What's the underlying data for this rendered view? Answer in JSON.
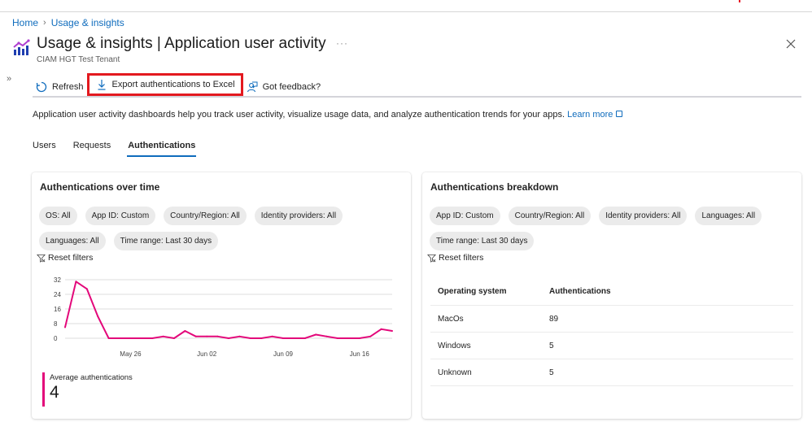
{
  "breadcrumb": {
    "items": [
      "Home",
      "Usage & insights"
    ]
  },
  "header": {
    "title_main": "Usage & insights",
    "title_sep": " | ",
    "title_page": "Application user activity",
    "subtitle": "CIAM HGT Test Tenant",
    "more_label": "···",
    "icon": "analytics-chart-icon"
  },
  "toolbar": {
    "refresh_label": "Refresh",
    "export_label": "Export authentications to Excel",
    "feedback_label": "Got feedback?"
  },
  "description": {
    "text": "Application user activity dashboards help you track user activity, visualize usage data, and analyze authentication trends for your apps. ",
    "link_label": "Learn more"
  },
  "tabs": [
    {
      "label": "Users",
      "active": false
    },
    {
      "label": "Requests",
      "active": false
    },
    {
      "label": "Authentications",
      "active": true
    }
  ],
  "left_card": {
    "title": "Authentications over time",
    "filters": [
      "OS: All",
      "App ID: Custom",
      "Country/Region: All",
      "Identity providers: All",
      "Languages: All",
      "Time range: Last 30 days"
    ],
    "reset_label": "Reset filters",
    "metric_label": "Average authentications",
    "metric_value": "4"
  },
  "right_card": {
    "title": "Authentications breakdown",
    "filters": [
      "App ID: Custom",
      "Country/Region: All",
      "Identity providers: All",
      "Languages: All",
      "Time range: Last 30 days"
    ],
    "reset_label": "Reset filters",
    "table": {
      "headers": [
        "Operating system",
        "Authentications"
      ],
      "rows": [
        [
          "MacOs",
          "89"
        ],
        [
          "Windows",
          "5"
        ],
        [
          "Unknown",
          "5"
        ]
      ]
    }
  },
  "colors": {
    "accent": "#0f6cbd",
    "series": "#e3087a",
    "highlight_box": "#e3191f"
  },
  "chart_data": {
    "type": "line",
    "title": "Authentications over time",
    "xlabel": "",
    "ylabel": "",
    "ylim": [
      0,
      32
    ],
    "y_ticks": [
      0,
      8,
      16,
      24,
      32
    ],
    "x_tick_labels": [
      "May 26",
      "Jun 02",
      "Jun 09",
      "Jun 16"
    ],
    "x_tick_index": [
      6,
      13,
      20,
      27
    ],
    "grid": true,
    "x": [
      "May 20",
      "May 21",
      "May 22",
      "May 23",
      "May 24",
      "May 25",
      "May 26",
      "May 27",
      "May 28",
      "May 29",
      "May 30",
      "May 31",
      "Jun 01",
      "Jun 02",
      "Jun 03",
      "Jun 04",
      "Jun 05",
      "Jun 06",
      "Jun 07",
      "Jun 08",
      "Jun 09",
      "Jun 10",
      "Jun 11",
      "Jun 12",
      "Jun 13",
      "Jun 14",
      "Jun 15",
      "Jun 16",
      "Jun 17",
      "Jun 18",
      "Jun 19"
    ],
    "series": [
      {
        "name": "Authentications",
        "values": [
          6,
          31,
          27,
          12,
          0,
          0,
          0,
          0,
          0,
          1,
          0,
          4,
          1,
          1,
          1,
          0,
          1,
          0,
          0,
          1,
          0,
          0,
          0,
          2,
          1,
          0,
          0,
          0,
          1,
          5,
          4
        ]
      }
    ]
  }
}
